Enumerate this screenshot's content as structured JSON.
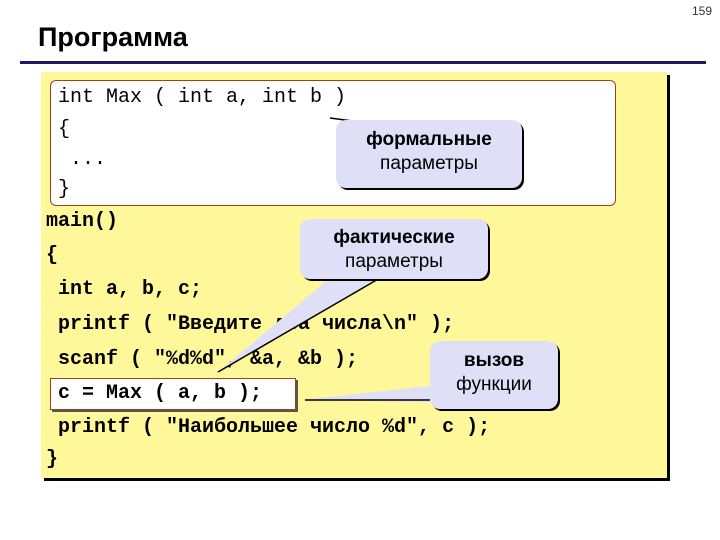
{
  "page_number": "159",
  "title": "Программа",
  "function_definition": {
    "lines": [
      "int Max ( int a, int b )",
      "{",
      " ...",
      "}"
    ]
  },
  "main_code": {
    "lines": [
      "main()",
      "{",
      " int a, b, c;",
      " printf ( \"Введите два числа\\n\" );",
      " scanf ( \"%d%d\", &a, &b );",
      " c = Max ( a, b );",
      " printf ( \"Наибольшее число %d\", c );",
      "}"
    ]
  },
  "callouts": {
    "formal": {
      "line1": "формальные",
      "line2": "параметры"
    },
    "actual": {
      "line1": "фактические",
      "line2": "параметры"
    },
    "call": {
      "line1": "вызов",
      "line2": "функции"
    }
  },
  "colors": {
    "panel": "#fff89a",
    "callout": "#dfe0f8",
    "border": "#a0411e",
    "rule": "#1a1a66"
  }
}
